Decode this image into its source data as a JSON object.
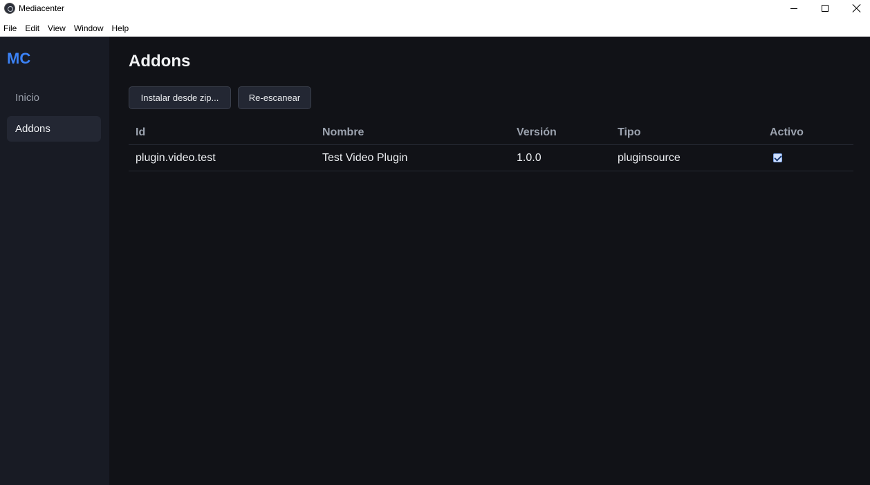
{
  "window": {
    "title": "Mediacenter"
  },
  "menu": [
    "File",
    "Edit",
    "View",
    "Window",
    "Help"
  ],
  "sidebar": {
    "brand": "MC",
    "items": [
      {
        "label": "Inicio",
        "active": false
      },
      {
        "label": "Addons",
        "active": true
      }
    ]
  },
  "main": {
    "title": "Addons",
    "buttons": {
      "install": "Instalar desde zip...",
      "rescan": "Re-escanear"
    },
    "table": {
      "headers": [
        "Id",
        "Nombre",
        "Versión",
        "Tipo",
        "Activo"
      ],
      "rows": [
        {
          "id": "plugin.video.test",
          "name": "Test Video Plugin",
          "version": "1.0.0",
          "type": "pluginsource",
          "active": true
        }
      ]
    }
  },
  "colors": {
    "accent": "#3b82f6",
    "sidebar_bg": "#181b24",
    "main_bg": "#111217"
  }
}
